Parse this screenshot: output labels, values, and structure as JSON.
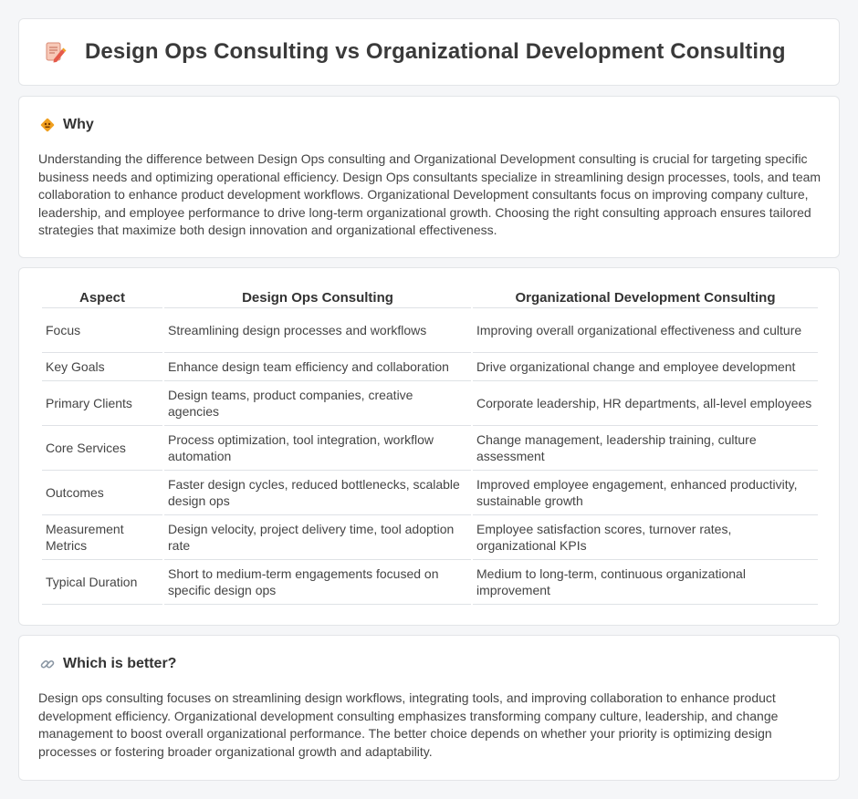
{
  "page": {
    "title": "Design Ops Consulting vs Organizational Development Consulting",
    "icon": "document-pencil-icon"
  },
  "why": {
    "icon": "diamond-sign-icon",
    "heading": "Why",
    "body": "Understanding the difference between Design Ops consulting and Organizational Development consulting is crucial for targeting specific business needs and optimizing operational efficiency. Design Ops consultants specialize in streamlining design processes, tools, and team collaboration to enhance product development workflows. Organizational Development consultants focus on improving company culture, leadership, and employee performance to drive long-term organizational growth. Choosing the right consulting approach ensures tailored strategies that maximize both design innovation and organizational effectiveness."
  },
  "comparison": {
    "headers": [
      "Aspect",
      "Design Ops Consulting",
      "Organizational Development Consulting"
    ],
    "rows": [
      [
        "Focus",
        "Streamlining design processes and workflows",
        "Improving overall organizational effectiveness and culture"
      ],
      [
        "Key Goals",
        "Enhance design team efficiency and collaboration",
        "Drive organizational change and employee development"
      ],
      [
        "Primary Clients",
        "Design teams, product companies, creative agencies",
        "Corporate leadership, HR departments, all-level employees"
      ],
      [
        "Core Services",
        "Process optimization, tool integration, workflow automation",
        "Change management, leadership training, culture assessment"
      ],
      [
        "Outcomes",
        "Faster design cycles, reduced bottlenecks, scalable design ops",
        "Improved employee engagement, enhanced productivity, sustainable growth"
      ],
      [
        "Measurement Metrics",
        "Design velocity, project delivery time, tool adoption rate",
        "Employee satisfaction scores, turnover rates, organizational KPIs"
      ],
      [
        "Typical Duration",
        "Short to medium-term engagements focused on specific design ops",
        "Medium to long-term, continuous organizational improvement"
      ]
    ]
  },
  "better": {
    "icon": "link-icon",
    "heading": "Which is better?",
    "body": "Design ops consulting focuses on streamlining design workflows, integrating tools, and improving collaboration to enhance product development efficiency. Organizational development consulting emphasizes transforming company culture, leadership, and change management to boost overall organizational performance. The better choice depends on whether your priority is optimizing design processes or fostering broader organizational growth and adaptability."
  },
  "colors": {
    "background": "#f5f6f8",
    "card": "#ffffff",
    "accent_orange": "#f0a020",
    "icon_red": "#e55a4a"
  }
}
